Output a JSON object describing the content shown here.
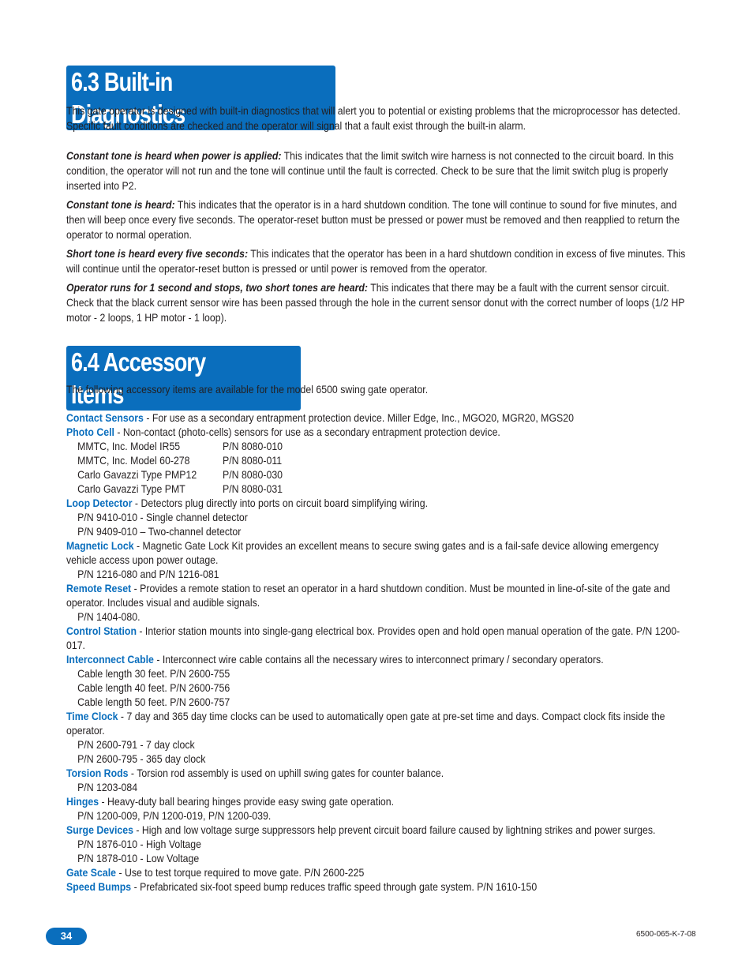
{
  "section_63": {
    "heading": "6.3 Built-in Diagnostics",
    "intro": "This gate operator is designed with built-in diagnostics that will alert you to potential or existing problems that the microprocessor has detected.  Specific fault conditions are checked and the operator will signal that a fault exist through the built-in alarm.",
    "conditions": [
      {
        "lead": "Constant tone is heard when power is applied:",
        "text": " This indicates that the limit switch wire harness is not connected to the circuit board.  In this condition, the operator will not run and the tone will continue until the fault is corrected.  Check to be sure that the limit switch plug is properly inserted into P2."
      },
      {
        "lead": "Constant tone is heard:",
        "text": " This indicates that the operator is in a hard shutdown condition.  The tone will continue to sound for five minutes, and then will beep once every five seconds.  The operator-reset button must be pressed or power must be removed and then reapplied to return the operator to normal operation."
      },
      {
        "lead": "Short tone is heard every five seconds:",
        "text": " This indicates that the operator has been in a hard shutdown condition in excess of five minutes.  This will continue until the operator-reset button is pressed or until power is removed from the operator."
      },
      {
        "lead": "Operator runs for 1 second and stops, two short tones are heard:",
        "text": " This indicates that there may be a fault with the current sensor circuit.  Check that the black current sensor wire has been passed through the hole in the current sensor donut with the correct number of loops (1/2 HP motor - 2 loops, 1 HP motor - 1 loop)."
      }
    ]
  },
  "section_64": {
    "heading": "6.4 Accessory Items",
    "intro": "The following accessory items are available for the model 6500 swing gate operator.",
    "items": [
      {
        "name": "Contact Sensors",
        "desc": " - For use as a secondary entrapment protection device. Miller Edge, Inc., MGO20, MGR20, MGS20",
        "sub": []
      },
      {
        "name": "Photo Cell",
        "desc": " - Non-contact (photo-cells) sensors for use as a secondary entrapment protection device.",
        "sub": [],
        "models": [
          {
            "model": "MMTC, Inc. Model IR55",
            "pn": "P/N 8080-010"
          },
          {
            "model": "MMTC, Inc. Model 60-278",
            "pn": "P/N 8080-011"
          },
          {
            "model": "Carlo Gavazzi Type PMP12",
            "pn": "P/N 8080-030"
          },
          {
            "model": "Carlo Gavazzi Type PMT",
            "pn": "P/N 8080-031"
          }
        ]
      },
      {
        "name": "Loop Detector",
        "desc": " - Detectors plug directly into ports on circuit board simplifying wiring.",
        "sub": [
          "P/N 9410-010 - Single channel detector",
          "P/N 9409-010 – Two-channel detector"
        ]
      },
      {
        "name": "Magnetic Lock",
        "desc": " - Magnetic Gate Lock Kit provides an excellent means to secure swing gates and is a fail-safe device allowing emergency vehicle access upon power outage.",
        "sub": [
          "P/N 1216-080 and P/N 1216-081"
        ]
      },
      {
        "name": "Remote Reset",
        "desc": " - Provides a remote station to reset an operator in a hard shutdown condition. Must be mounted in line-of-site of the gate and operator. Includes visual and audible signals.",
        "sub": [
          "P/N 1404-080."
        ]
      },
      {
        "name": "Control Station",
        "desc": " - Interior station mounts into single-gang electrical box. Provides open and hold open manual operation of the gate. P/N 1200-017.",
        "sub": []
      },
      {
        "name": "Interconnect Cable",
        "desc": " - Interconnect wire cable contains all the necessary wires to interconnect primary / secondary operators.",
        "sub": [
          "Cable length 30 feet. P/N 2600-755",
          "Cable length 40 feet. P/N 2600-756",
          "Cable length 50 feet. P/N 2600-757"
        ]
      },
      {
        "name": "Time Clock",
        "desc": " - 7 day and 365 day time clocks can be used to automatically open gate at pre-set time and days. Compact clock fits inside the operator.",
        "sub": [
          "P/N 2600-791 - 7 day clock",
          "P/N 2600-795 - 365 day clock"
        ]
      },
      {
        "name": "Torsion Rods",
        "desc": " - Torsion rod assembly is used on uphill swing gates for counter balance.",
        "sub": [
          "P/N 1203-084"
        ]
      },
      {
        "name": "Hinges",
        "desc": " - Heavy-duty ball bearing hinges provide easy swing gate operation.",
        "sub": [
          "P/N 1200-009, P/N 1200-019, P/N 1200-039."
        ]
      },
      {
        "name": "Surge Devices",
        "desc": " - High and low voltage surge suppressors help prevent circuit board failure caused by lightning strikes and power surges.",
        "sub": [
          "P/N 1876-010 - High Voltage",
          "P/N 1878-010 - Low Voltage"
        ]
      },
      {
        "name": "Gate Scale",
        "desc": " - Use to test torque required to move gate. P/N 2600-225",
        "sub": []
      },
      {
        "name": "Speed Bumps",
        "desc": " - Prefabricated six-foot speed bump reduces traffic speed through gate system. P/N 1610-150",
        "sub": []
      }
    ]
  },
  "footer": {
    "page_number": "34",
    "doc_code": "6500-065-K-7-08"
  },
  "colors": {
    "accent": "#0a6ebd",
    "text": "#231f20"
  }
}
